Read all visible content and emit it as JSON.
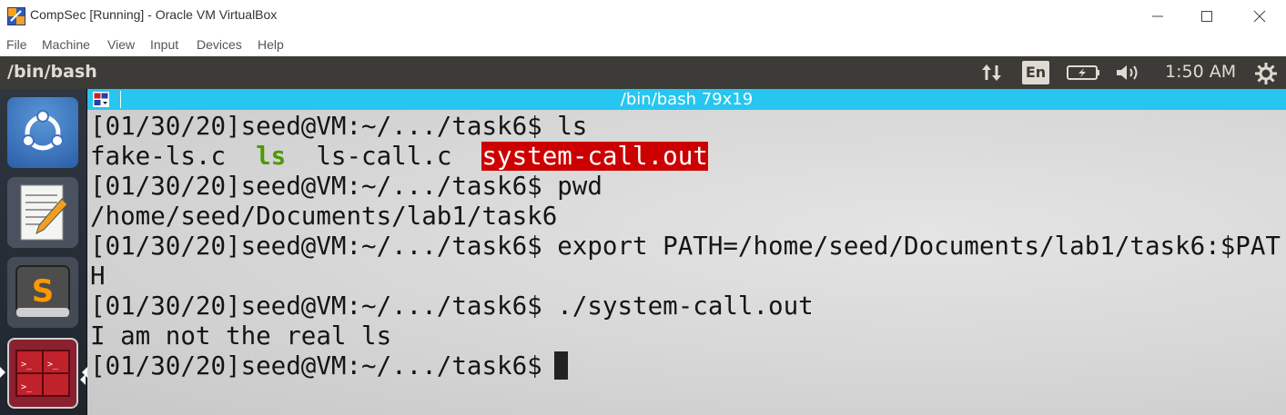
{
  "window": {
    "title": "CompSec [Running] - Oracle VM VirtualBox",
    "controls": [
      "minimize",
      "maximize",
      "close"
    ]
  },
  "menubar": {
    "items": [
      "File",
      "Machine",
      "View",
      "Input",
      "Devices",
      "Help"
    ]
  },
  "panel": {
    "title": "/bin/bash",
    "language": "En",
    "clock": "1:50 AM",
    "icons": [
      "network-icon",
      "keyboard-language-icon",
      "battery-icon",
      "volume-icon",
      "gear-icon"
    ]
  },
  "launcher": {
    "items": [
      "ubuntu-dash-icon",
      "text-editor-icon",
      "sublime-text-icon",
      "terminal-icon"
    ]
  },
  "terminal": {
    "title": "/bin/bash 79x19",
    "lines": [
      {
        "prompt": "[01/30/20]seed@VM:~/.../task6$ ",
        "cmd": "ls"
      },
      {
        "out": [
          "fake-ls.c  ",
          "ls",
          "  ls-call.c  ",
          "system-call.out"
        ]
      },
      {
        "prompt": "[01/30/20]seed@VM:~/.../task6$ ",
        "cmd": "pwd"
      },
      {
        "text": "/home/seed/Documents/lab1/task6"
      },
      {
        "prompt": "[01/30/20]seed@VM:~/.../task6$ ",
        "cmd": "export PATH=/home/seed/Documents/lab1/task6:$PAT"
      },
      {
        "text": "H"
      },
      {
        "prompt": "[01/30/20]seed@VM:~/.../task6$ ",
        "cmd": "./system-call.out"
      },
      {
        "text": "I am not the real ls"
      },
      {
        "prompt": "[01/30/20]seed@VM:~/.../task6$ ",
        "cmd": ""
      }
    ]
  },
  "colors": {
    "terminal_header": "#26c6f0",
    "panel_bg": "#3c3b37",
    "exec_green": "#4e9a06",
    "highlight_red": "#cc0000"
  }
}
